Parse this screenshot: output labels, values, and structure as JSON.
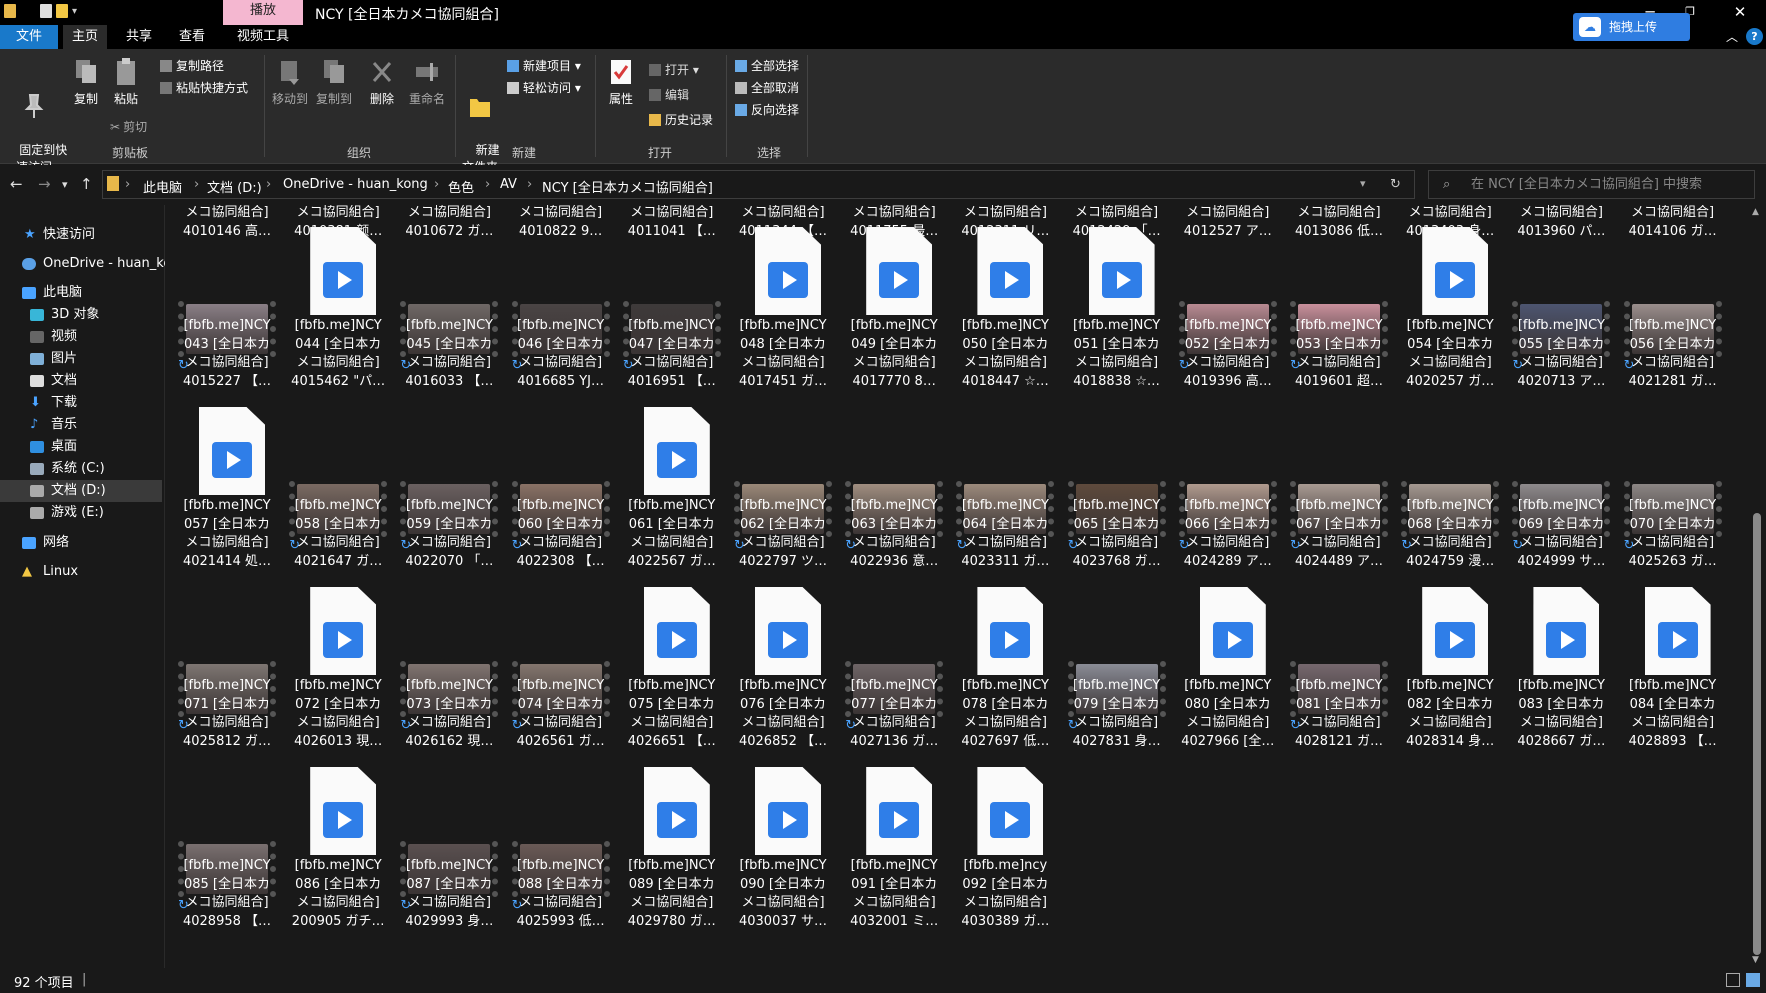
{
  "window": {
    "title": "NCY [全日本カメコ協同組合]",
    "context_tab": "播放",
    "upload_button": "拖拽上传"
  },
  "menu": {
    "tabs": [
      "文件",
      "主页",
      "共享",
      "查看",
      "视频工具"
    ]
  },
  "ribbon": {
    "clipboard": {
      "pin": "固定到快\n速访问",
      "copy": "复制",
      "paste": "粘贴",
      "copy_path": "复制路径",
      "paste_shortcut": "粘贴快捷方式",
      "cut": "剪切",
      "group": "剪贴板"
    },
    "organize": {
      "move_to": "移动到",
      "copy_to": "复制到",
      "delete": "删除",
      "rename": "重命名",
      "group": "组织"
    },
    "new": {
      "new_folder": "新建\n文件夹",
      "new_item": "新建项目",
      "easy_access": "轻松访问",
      "group": "新建"
    },
    "open": {
      "properties": "属性",
      "open": "打开",
      "edit": "编辑",
      "history": "历史记录",
      "group": "打开"
    },
    "select": {
      "select_all": "全部选择",
      "select_none": "全部取消",
      "invert": "反向选择",
      "group": "选择"
    }
  },
  "address": {
    "crumbs": [
      "此电脑",
      "文档 (D:)",
      "OneDrive - huan_kong",
      "色色",
      "AV",
      "NCY [全日本カメコ協同組合]"
    ],
    "search_placeholder": "在 NCY [全日本カメコ協同組合] 中搜索"
  },
  "nav": {
    "items": [
      {
        "label": "快速访问",
        "icon": "star-icon"
      },
      {
        "label": "OneDrive - huan_kong",
        "icon": "cloud-icon"
      },
      {
        "label": "此电脑",
        "icon": "computer-icon"
      },
      {
        "label": "3D 对象",
        "icon": "cube-icon"
      },
      {
        "label": "视频",
        "icon": "video-icon"
      },
      {
        "label": "图片",
        "icon": "picture-icon"
      },
      {
        "label": "文档",
        "icon": "document-icon"
      },
      {
        "label": "下载",
        "icon": "download-icon"
      },
      {
        "label": "音乐",
        "icon": "music-icon"
      },
      {
        "label": "桌面",
        "icon": "desktop-icon"
      },
      {
        "label": "系统 (C:)",
        "icon": "drive-icon"
      },
      {
        "label": "文档 (D:)",
        "icon": "drive-icon"
      },
      {
        "label": "游戏 (E:)",
        "icon": "drive-icon"
      },
      {
        "label": "网络",
        "icon": "network-icon"
      },
      {
        "label": "Linux",
        "icon": "linux-icon"
      }
    ]
  },
  "files": {
    "partial_row": [
      "メコ協同組合]\n4010146 高…",
      "メコ協同組合]\n4010381 颜…",
      "メコ協同組合]\n4010672 ガ…",
      "メコ協同組合]\n4010822 9…",
      "メコ協同組合]\n4011041 【…",
      "メコ協同組合]\n4011344 【…",
      "メコ協同組合]\n4011755 最…",
      "メコ協同組合]\n4012311 リ…",
      "メコ協同組合]\n4012429 「…",
      "メコ協同組合]\n4012527 ア…",
      "メコ協同組合]\n4013086 低…",
      "メコ協同組合]\n4013403 身…",
      "メコ協同組合]\n4013960 パ…",
      "メコ協同組合]\n4014106 ガ…"
    ],
    "items": [
      {
        "label": "[fbfb.me]NCY\n043 [全日本カ\nメコ協同組合]\n4015227 【…",
        "kind": "thumb",
        "sync": true,
        "color": "#8a7f86"
      },
      {
        "label": "[fbfb.me]NCY\n044 [全日本カ\nメコ協同組合]\n4015462 \"パ…",
        "kind": "doc",
        "sync": false
      },
      {
        "label": "[fbfb.me]NCY\n045 [全日本カ\nメコ協同組合]\n4016033 【…",
        "kind": "thumb",
        "sync": true,
        "color": "#6f6866"
      },
      {
        "label": "[fbfb.me]NCY\n046 [全日本カ\nメコ協同組合]\n4016685 YJ…",
        "kind": "thumb",
        "sync": true,
        "color": "#4a4444"
      },
      {
        "label": "[fbfb.me]NCY\n047 [全日本カ\nメコ協同組合]\n4016951 【…",
        "kind": "thumb",
        "sync": true,
        "color": "#3e3a3a"
      },
      {
        "label": "[fbfb.me]NCY\n048 [全日本カ\nメコ協同組合]\n4017451 ガ…",
        "kind": "doc",
        "sync": false
      },
      {
        "label": "[fbfb.me]NCY\n049 [全日本カ\nメコ協同組合]\n4017770 8…",
        "kind": "doc",
        "sync": false
      },
      {
        "label": "[fbfb.me]NCY\n050 [全日本カ\nメコ協同組合]\n4018447 ☆…",
        "kind": "doc",
        "sync": false
      },
      {
        "label": "[fbfb.me]NCY\n051 [全日本カ\nメコ協同組合]\n4018838 ☆…",
        "kind": "doc",
        "sync": false
      },
      {
        "label": "[fbfb.me]NCY\n052 [全日本カ\nメコ協同組合]\n4019396 高…",
        "kind": "thumb",
        "sync": true,
        "color": "#b88a92"
      },
      {
        "label": "[fbfb.me]NCY\n053 [全日本カ\nメコ協同組合]\n4019601 超…",
        "kind": "thumb",
        "sync": true,
        "color": "#c9909c"
      },
      {
        "label": "[fbfb.me]NCY\n054 [全日本カ\nメコ協同組合]\n4020257 ガ…",
        "kind": "doc",
        "sync": false
      },
      {
        "label": "[fbfb.me]NCY\n055 [全日本カ\nメコ協同組合]\n4020713 ア…",
        "kind": "thumb",
        "sync": true,
        "color": "#4d5570"
      },
      {
        "label": "[fbfb.me]NCY\n056 [全日本カ\nメコ協同組合]\n4021281 ガ…",
        "kind": "thumb",
        "sync": true,
        "color": "#9a8e8c"
      },
      {
        "label": "[fbfb.me]NCY\n057 [全日本カ\nメコ協同組合]\n4021414 処…",
        "kind": "doc",
        "sync": false
      },
      {
        "label": "[fbfb.me]NCY\n058 [全日本カ\nメコ協同組合]\n4021647 ガ…",
        "kind": "thumb",
        "sync": true,
        "color": "#7a6a62"
      },
      {
        "label": "[fbfb.me]NCY\n059 [全日本カ\nメコ協同組合]\n4022070 「…",
        "kind": "thumb",
        "sync": true,
        "color": "#6a6060"
      },
      {
        "label": "[fbfb.me]NCY\n060 [全日本カ\nメコ協同組合]\n4022308 【…",
        "kind": "thumb",
        "sync": true,
        "color": "#8a7266"
      },
      {
        "label": "[fbfb.me]NCY\n061 [全日本カ\nメコ協同組合]\n4022567 ガ…",
        "kind": "doc",
        "sync": false
      },
      {
        "label": "[fbfb.me]NCY\n062 [全日本カ\nメコ協同組合]\n4022797 ツ…",
        "kind": "thumb",
        "sync": true,
        "color": "#9a8878"
      },
      {
        "label": "[fbfb.me]NCY\n063 [全日本カ\nメコ協同組合]\n4022936 意…",
        "kind": "thumb",
        "sync": true,
        "color": "#a08e80"
      },
      {
        "label": "[fbfb.me]NCY\n064 [全日本カ\nメコ協同組合]\n4023311 ガ…",
        "kind": "thumb",
        "sync": true,
        "color": "#9c8a7c"
      },
      {
        "label": "[fbfb.me]NCY\n065 [全日本カ\nメコ協同組合]\n4023768 ガ…",
        "kind": "thumb",
        "sync": true,
        "color": "#5e4a3c"
      },
      {
        "label": "[fbfb.me]NCY\n066 [全日本カ\nメコ協同組合]\n4024289 ア…",
        "kind": "thumb",
        "sync": true,
        "color": "#b09a8e"
      },
      {
        "label": "[fbfb.me]NCY\n067 [全日本カ\nメコ協同組合]\n4024489 ア…",
        "kind": "thumb",
        "sync": true,
        "color": "#a89a92"
      },
      {
        "label": "[fbfb.me]NCY\n068 [全日本カ\nメコ協同組合]\n4024759 漫…",
        "kind": "thumb",
        "sync": true,
        "color": "#a49890"
      },
      {
        "label": "[fbfb.me]NCY\n069 [全日本カ\nメコ協同組合]\n4024999 サ…",
        "kind": "thumb",
        "sync": true,
        "color": "#8e8a8c"
      },
      {
        "label": "[fbfb.me]NCY\n070 [全日本カ\nメコ協同組合]\n4025263 ガ…",
        "kind": "thumb",
        "sync": true,
        "color": "#8c8684"
      },
      {
        "label": "[fbfb.me]NCY\n071 [全日本カ\nメコ協同組合]\n4025812 ガ…",
        "kind": "thumb",
        "sync": true,
        "color": "#7e7672"
      },
      {
        "label": "[fbfb.me]NCY\n072 [全日本カ\nメコ協同組合]\n4026013 現…",
        "kind": "doc",
        "sync": false
      },
      {
        "label": "[fbfb.me]NCY\n073 [全日本カ\nメコ協同組合]\n4026162 現…",
        "kind": "thumb",
        "sync": true,
        "color": "#807470"
      },
      {
        "label": "[fbfb.me]NCY\n074 [全日本カ\nメコ協同組合]\n4026561 ガ…",
        "kind": "thumb",
        "sync": true,
        "color": "#84766e"
      },
      {
        "label": "[fbfb.me]NCY\n075 [全日本カ\nメコ協同組合]\n4026651 【…",
        "kind": "doc",
        "sync": false
      },
      {
        "label": "[fbfb.me]NCY\n076 [全日本カ\nメコ協同組合]\n4026852 【…",
        "kind": "doc",
        "sync": false
      },
      {
        "label": "[fbfb.me]NCY\n077 [全日本カ\nメコ協同組合]\n4027136 ガ…",
        "kind": "thumb",
        "sync": true,
        "color": "#6e6466"
      },
      {
        "label": "[fbfb.me]NCY\n078 [全日本カ\nメコ協同組合]\n4027697 低…",
        "kind": "doc",
        "sync": false
      },
      {
        "label": "[fbfb.me]NCY\n079 [全日本カ\nメコ協同組合]\n4027831 身…",
        "kind": "thumb",
        "sync": true,
        "color": "#8a8c96"
      },
      {
        "label": "[fbfb.me]NCY\n080 [全日本カ\nメコ協同組合]\n4027966 [全…",
        "kind": "doc",
        "sync": false
      },
      {
        "label": "[fbfb.me]NCY\n081 [全日本カ\nメコ協同組合]\n4028121 ガ…",
        "kind": "thumb",
        "sync": true,
        "color": "#76686e"
      },
      {
        "label": "[fbfb.me]NCY\n082 [全日本カ\nメコ協同組合]\n4028314 身…",
        "kind": "doc",
        "sync": false
      },
      {
        "label": "[fbfb.me]NCY\n083 [全日本カ\nメコ協同組合]\n4028667 ガ…",
        "kind": "doc",
        "sync": false
      },
      {
        "label": "[fbfb.me]NCY\n084 [全日本カ\nメコ協同組合]\n4028893 【…",
        "kind": "doc",
        "sync": false
      },
      {
        "label": "[fbfb.me]NCY\n085 [全日本カ\nメコ協同組合]\n4028958 【…",
        "kind": "thumb",
        "sync": true,
        "color": "#7a7070"
      },
      {
        "label": "[fbfb.me]NCY\n086 [全日本カ\nメコ協同組合]\n200905 ガチ…",
        "kind": "doc",
        "sync": false
      },
      {
        "label": "[fbfb.me]NCY\n087 [全日本カ\nメコ協同組合]\n4029993 身…",
        "kind": "thumb",
        "sync": true,
        "color": "#5a5050"
      },
      {
        "label": "[fbfb.me]NCY\n088 [全日本カ\nメコ協同組合]\n4025993 低…",
        "kind": "thumb",
        "sync": true,
        "color": "#6a5a56"
      },
      {
        "label": "[fbfb.me]NCY\n089 [全日本カ\nメコ協同組合]\n4029780 ガ…",
        "kind": "doc",
        "sync": false
      },
      {
        "label": "[fbfb.me]NCY\n090 [全日本カ\nメコ協同組合]\n4030037 サ…",
        "kind": "doc",
        "sync": false
      },
      {
        "label": "[fbfb.me]NCY\n091 [全日本カ\nメコ協同組合]\n4032001 ミ…",
        "kind": "doc",
        "sync": false
      },
      {
        "label": "[fbfb.me]ncy\n092 [全日本カ\nメコ協同組合]\n4030389 ガ…",
        "kind": "doc",
        "sync": false
      }
    ]
  },
  "status": {
    "count": "92 个项目"
  },
  "colors": {
    "accent": "#1979ca",
    "upload": "#2f7de1",
    "context_tab": "#f4b7d0",
    "play": "#2f7ee8"
  }
}
